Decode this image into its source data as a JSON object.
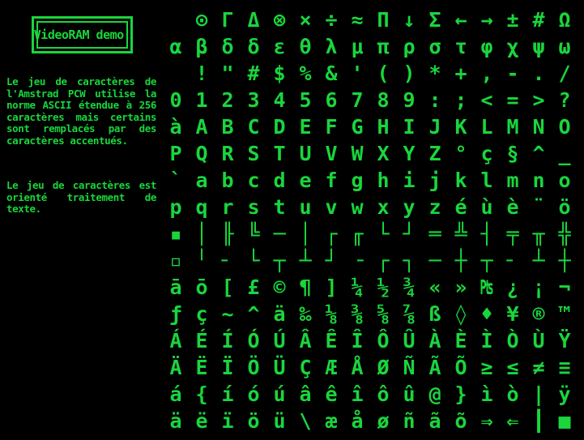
{
  "screen": {
    "title": "VideoRAM demo!",
    "paragraph1": "Le jeu de caractères de l'Amstrad PCW utilise la norme ASCII étendue à 256 caractères mais certains sont remplacés par des caractères accentués.",
    "paragraph2": "Le jeu de caractères est orienté traitement de texte.",
    "text_color": "#19d63c",
    "background_color": "#000000"
  },
  "charset": {
    "rows": [
      [
        "",
        "⊙",
        "Γ",
        "Δ",
        "⊗",
        "×",
        "÷",
        "≈",
        "Π",
        "↓",
        "Σ",
        "←",
        "→",
        "±",
        "#",
        "Ω"
      ],
      [
        "α",
        "β",
        "δ",
        "δ",
        "ε",
        "θ",
        "λ",
        "μ",
        "π",
        "ρ",
        "σ",
        "τ",
        "φ",
        "χ",
        "ψ",
        "ω"
      ],
      [
        "",
        "!",
        "\"",
        "#",
        "$",
        "%",
        "&",
        "'",
        "(",
        ")",
        "*",
        "+",
        ",",
        "-",
        ".",
        "/"
      ],
      [
        "0",
        "1",
        "2",
        "3",
        "4",
        "5",
        "6",
        "7",
        "8",
        "9",
        ":",
        ";",
        "<",
        "=",
        ">",
        "?"
      ],
      [
        "à",
        "A",
        "B",
        "C",
        "D",
        "E",
        "F",
        "G",
        "H",
        "I",
        "J",
        "K",
        "L",
        "M",
        "N",
        "O"
      ],
      [
        "P",
        "Q",
        "R",
        "S",
        "T",
        "U",
        "V",
        "W",
        "X",
        "Y",
        "Z",
        "°",
        "ç",
        "§",
        "^",
        "_"
      ],
      [
        "`",
        "a",
        "b",
        "c",
        "d",
        "e",
        "f",
        "g",
        "h",
        "i",
        "j",
        "k",
        "l",
        "m",
        "n",
        "o"
      ],
      [
        "p",
        "q",
        "r",
        "s",
        "t",
        "u",
        "v",
        "w",
        "x",
        "y",
        "z",
        "é",
        "ù",
        "è",
        "¨",
        "ö"
      ],
      [
        "▪",
        "│",
        "╟",
        "╚",
        "─",
        "│",
        "┌",
        "╓",
        "└",
        "┘",
        "═",
        "╩",
        "┤",
        "╤",
        "╥",
        "╬"
      ],
      [
        "▫",
        "╵",
        "╴",
        "└",
        "┬",
        "┴",
        "┘",
        "╶",
        "┌",
        "┐",
        "─",
        "┼",
        "┬",
        "╴",
        "┴",
        "┼"
      ],
      [
        "ā",
        "ō",
        "[",
        "£",
        "©",
        "¶",
        "]",
        "¼",
        "½",
        "¾",
        "«",
        "»",
        "₧",
        "¿",
        "¡",
        "¬"
      ],
      [
        "ƒ",
        "ç",
        "~",
        "^",
        "ä",
        "‰",
        "⅛",
        "⅜",
        "⅝",
        "⅞",
        "ß",
        "◊",
        "♦",
        "¥",
        "®",
        "™"
      ],
      [
        "Á",
        "É",
        "Í",
        "Ó",
        "Ú",
        "Â",
        "Ê",
        "Î",
        "Ô",
        "Û",
        "À",
        "È",
        "Ì",
        "Ò",
        "Ù",
        "Ÿ"
      ],
      [
        "Ä",
        "Ë",
        "Ï",
        "Ö",
        "Ü",
        "Ç",
        "Æ",
        "Å",
        "Ø",
        "Ñ",
        "Ã",
        "Õ",
        "≥",
        "≤",
        "≠",
        "≡"
      ],
      [
        "á",
        "{",
        "í",
        "ó",
        "ú",
        "â",
        "ê",
        "î",
        "ô",
        "û",
        "@",
        "}",
        "ì",
        "ò",
        "|",
        "ÿ"
      ],
      [
        "ä",
        "ë",
        "ï",
        "ö",
        "ü",
        "\\",
        "æ",
        "å",
        "ø",
        "ñ",
        "ã",
        "õ",
        "⇒",
        "⇐",
        "┃",
        "■"
      ]
    ]
  }
}
